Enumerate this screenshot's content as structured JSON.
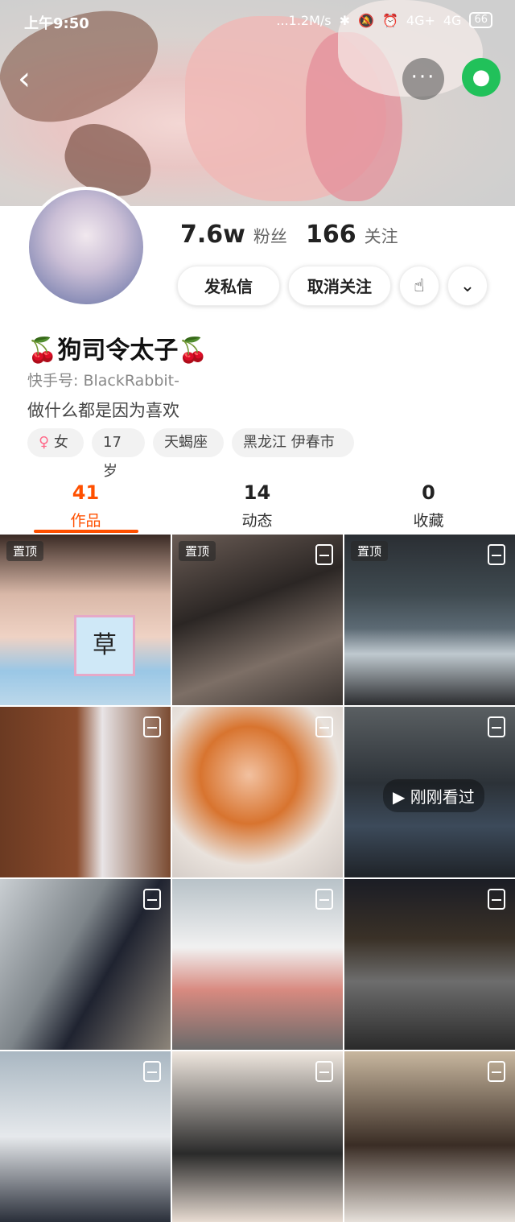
{
  "status_bar": {
    "time": "上午9:50",
    "network_speed": "...1.2M/s",
    "signal_1": "4G+",
    "signal_2": "4G",
    "battery": "66"
  },
  "header": {
    "back_icon": "chevron-left-icon",
    "more_label": "···",
    "wechat_icon": "wechat-icon"
  },
  "stats": {
    "followers_value": "7.6w",
    "followers_label": "粉丝",
    "following_value": "166",
    "following_label": "关注"
  },
  "actions": {
    "message_label": "发私信",
    "unfollow_label": "取消关注",
    "touch_icon": "hand-pointer-icon",
    "expand_icon": "chevron-down-icon"
  },
  "profile": {
    "name": "🍒狗司令太子🍒",
    "kuaishou_id": "快手号: BlackRabbit-",
    "bio": "做什么都是因为喜欢",
    "tags": [
      "女",
      "17岁",
      "天蝎座",
      "黑龙江 伊春市"
    ]
  },
  "tabs": [
    {
      "count": "41",
      "label": "作品"
    },
    {
      "count": "14",
      "label": "动态"
    },
    {
      "count": "0",
      "label": "收藏"
    }
  ],
  "grid": {
    "pinned_label": "置顶",
    "recently_viewed": "▶ 刚刚看过",
    "sticker_text": "草"
  }
}
